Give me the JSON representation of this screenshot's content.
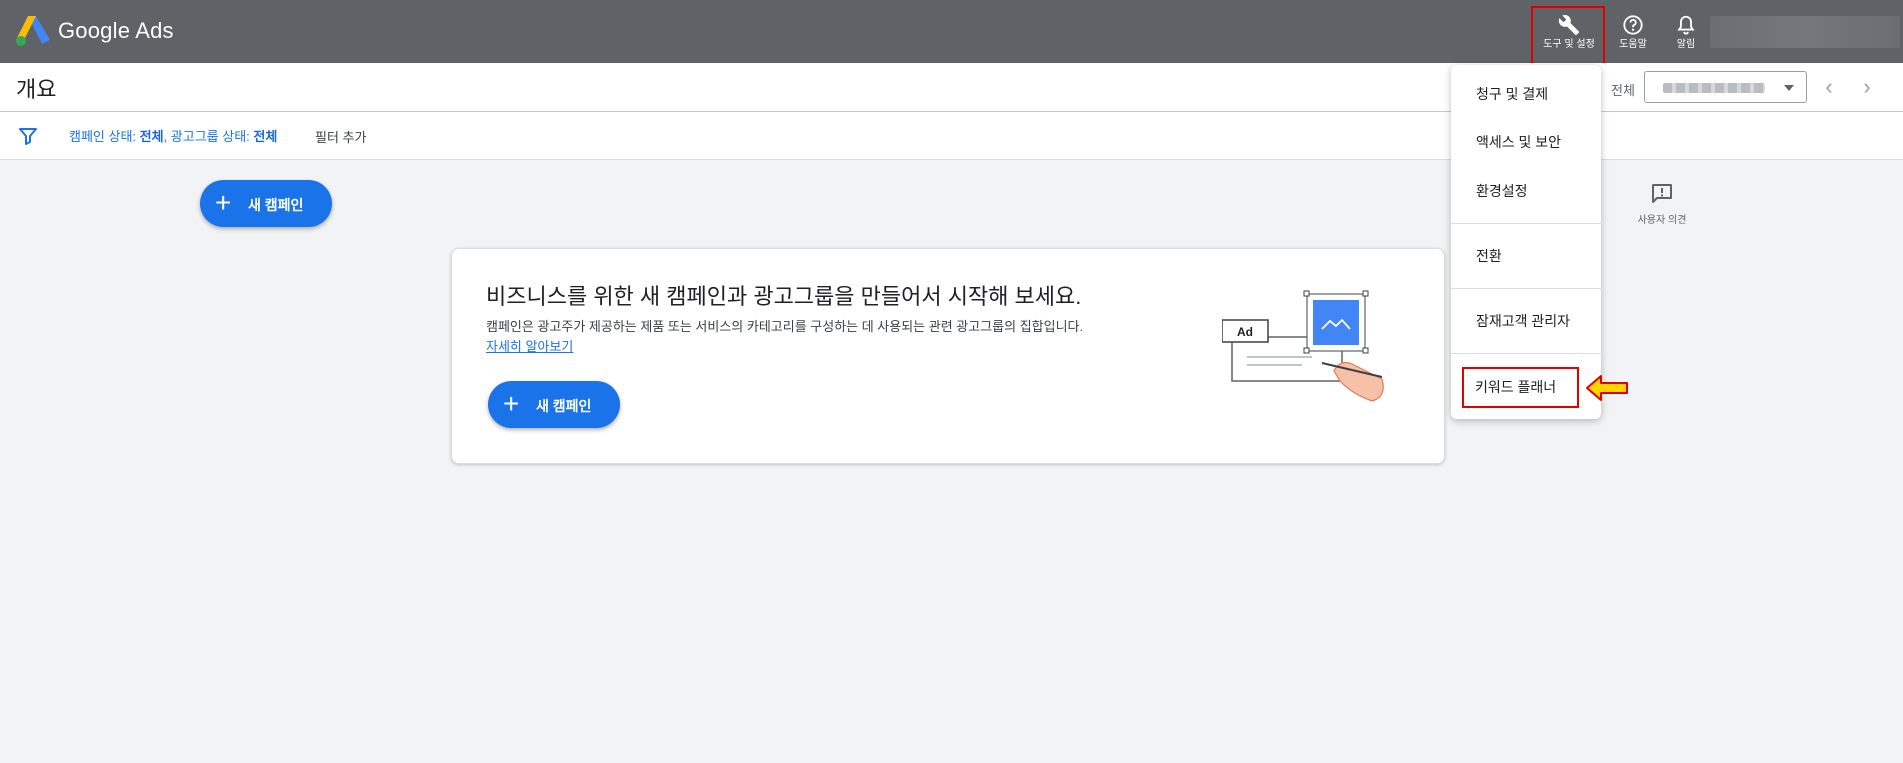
{
  "app": {
    "brand": "Google Ads",
    "actions": {
      "tools_label": "도구 및 설정",
      "help_label": "도움말",
      "alerts_label": "알림"
    }
  },
  "header": {
    "title": "개요",
    "scope_label": "전체"
  },
  "filters": {
    "chip_prefix_1": "캠페인 상태: ",
    "chip_value_1": "전체",
    "chip_prefix_2": ", 광고그룹 상태: ",
    "chip_value_2": "전체",
    "add_filter": "필터 추가"
  },
  "main": {
    "new_campaign_label": "새 캠페인",
    "feedback_label": "사용자 의견",
    "card": {
      "title": "비즈니스를 위한 새 캠페인과 광고그룹을 만들어서 시작해 보세요.",
      "description": "캠페인은 광고주가 제공하는 제품 또는 서비스의 카테고리를 구성하는 데 사용되는 관련 광고그룹의 집합입니다.",
      "learn_more": "자세히 알아보기",
      "button_label": "새 캠페인",
      "illustration_badge": "Ad"
    }
  },
  "menu": {
    "items": [
      "청구 및 결제",
      "액세스 및 보안",
      "환경설정",
      "전환",
      "잠재고객 관리자",
      "키워드 플래너"
    ]
  },
  "colors": {
    "topbar": "#5f6368",
    "primary": "#1a73e8",
    "highlight": "#e00000",
    "arrow_fill": "#ffd400"
  },
  "icons": {
    "tools": "wrench-icon",
    "help": "help-circle-icon",
    "alerts": "bell-icon",
    "filter": "filter-icon",
    "feedback": "feedback-icon"
  }
}
